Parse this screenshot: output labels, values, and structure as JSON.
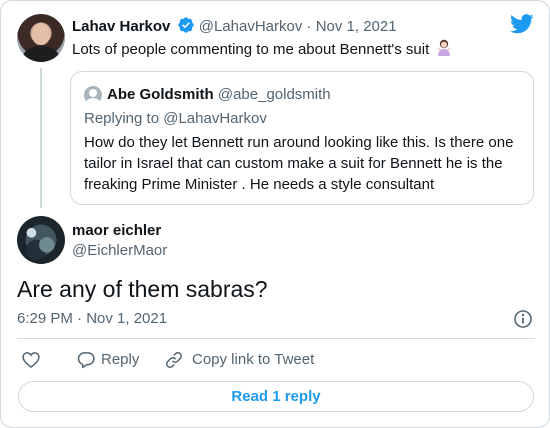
{
  "parent": {
    "name": "Lahav Harkov",
    "handle": "@LahavHarkov",
    "separator": "·",
    "date": "Nov 1, 2021",
    "text": "Lots of people commenting to me about Bennett's suit",
    "emoji_icon": "woman-shrugging-emoji"
  },
  "quote": {
    "name": "Abe Goldsmith",
    "handle": "@abe_goldsmith",
    "replying_prefix": "Replying to",
    "replying_to": "@LahavHarkov",
    "text": "How do they let Bennett run around looking like this. Is there one tailor in Israel that can custom make a suit for Bennett he is the freaking Prime Minister . He needs a style consultant"
  },
  "main": {
    "name": "maor eichler",
    "handle": "@EichlerMaor",
    "text": "Are any of them sabras?",
    "timestamp": "6:29 PM · Nov 1, 2021"
  },
  "actions": {
    "like_icon": "heart-icon",
    "reply_label": "Reply",
    "reply_icon": "speech-bubble-icon",
    "copy_label": "Copy link to Tweet",
    "copy_icon": "link-icon"
  },
  "read_button": "Read 1 reply",
  "colors": {
    "accent": "#1d9bf0",
    "text": "#0f1419",
    "muted": "#536471",
    "border": "#cfd9de"
  }
}
